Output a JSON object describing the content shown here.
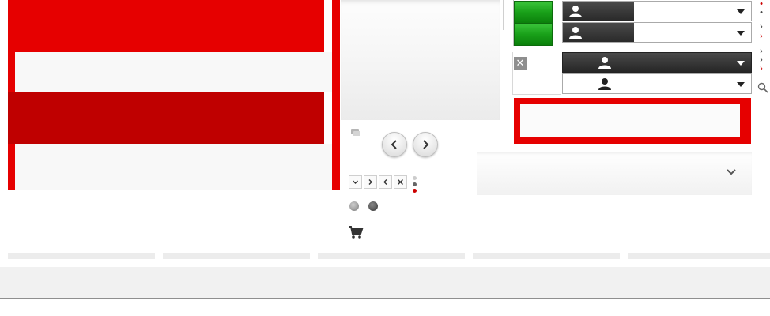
{
  "left_panel": {
    "accent_red": "#e60000",
    "dark_red": "#bf0000"
  },
  "carousel": {
    "prev_icon": "chevron-left-icon",
    "next_icon": "chevron-right-icon"
  },
  "mini_controls": [
    "chevron-down-icon",
    "chevron-right-icon",
    "chevron-left-icon",
    "close-icon"
  ],
  "pager_dots": [
    {
      "state": "inactive",
      "color": "#cccccc"
    },
    {
      "state": "inactive",
      "color": "#666666"
    },
    {
      "state": "active",
      "color": "#cc0000"
    }
  ],
  "status_balls": [
    {
      "color": "#9a9a9a"
    },
    {
      "color": "#444444"
    }
  ],
  "green_buttons": {
    "color": "#19a019",
    "count": 2
  },
  "user_selects": [
    {
      "icon": "user-icon",
      "style": "light"
    },
    {
      "icon": "user-icon",
      "style": "light"
    },
    {
      "icon": "user-icon",
      "style": "dark"
    },
    {
      "icon": "user-icon",
      "style": "plain"
    }
  ],
  "right_icons": [
    "dot-red-icon",
    "dot-grey-icon",
    "chevron-right-icon",
    "chevron-right-red-icon",
    "chevron-right-icon",
    "chevron-right-icon",
    "chevron-right-red-icon",
    "search-icon"
  ],
  "tabs_count": 5
}
